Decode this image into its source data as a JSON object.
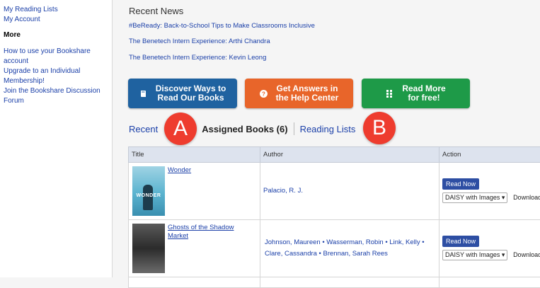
{
  "sidebar": {
    "links_top": [
      "My Reading Lists",
      "My Account"
    ],
    "more_heading": "More",
    "links_more": [
      "How to use your Bookshare account",
      "Upgrade to an Individual Membership!",
      "Join the Bookshare Discussion Forum"
    ]
  },
  "news": {
    "heading": "Recent News",
    "items": [
      "#BeReady: Back-to-School Tips to Make Classrooms Inclusive",
      "The Benetech Intern Experience: Arthi Chandra",
      "The Benetech Intern Experience: Kevin Leong"
    ]
  },
  "cta": {
    "discover": {
      "line1": "Discover Ways to",
      "line2": "Read Our Books",
      "color": "#1f62a0",
      "icon": "book-icon"
    },
    "help": {
      "line1": "Get Answers in",
      "line2": "the Help Center",
      "color": "#e8652a",
      "icon": "question-icon"
    },
    "readmore": {
      "line1": "Read More",
      "line2": "for free!",
      "color": "#1e9a48",
      "icon": "grid-icon"
    }
  },
  "tabs": {
    "recent": "Recent",
    "assigned": "Assigned Books (6)",
    "reading_lists": "Reading Lists"
  },
  "markers": {
    "a": "A",
    "b": "B",
    "color": "#ee3c2e"
  },
  "table": {
    "headers": [
      "Title",
      "Author",
      "Action"
    ],
    "rows": [
      {
        "title": "Wonder",
        "cover_word": "WONDER",
        "author": "Palacio, R. J.",
        "read_now": "Read Now",
        "format": "DAISY with Images",
        "download": "Download"
      },
      {
        "title": "Ghosts of the Shadow Market",
        "author": "Johnson, Maureen • Wasserman, Robin • Link, Kelly • Clare, Cassandra • Brennan, Sarah Rees",
        "read_now": "Read Now",
        "format": "DAISY with Images",
        "download": "Download"
      }
    ]
  },
  "colors": {
    "link": "#1a3fa8",
    "header_bg": "#dde3ee"
  }
}
